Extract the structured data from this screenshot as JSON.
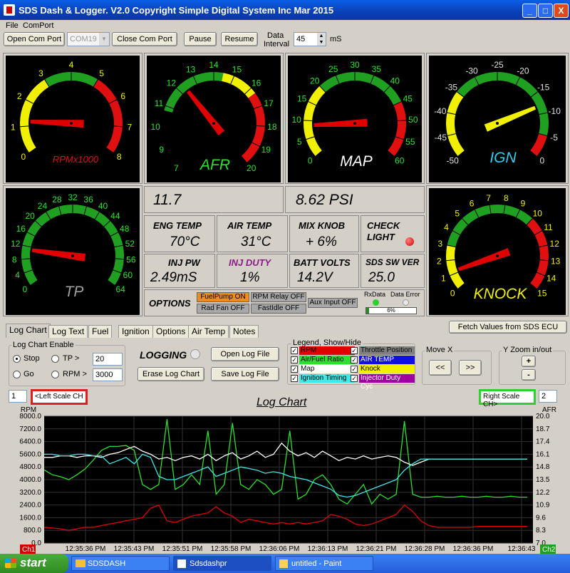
{
  "window": {
    "title": "SDS Dash & Logger. V2.0 Copyright Simple Digital System Inc Mar 2015",
    "min": "_",
    "max": "□",
    "close": "X"
  },
  "menu": {
    "file": "File",
    "comport": "ComPort"
  },
  "toolbar": {
    "open_com": "Open Com Port",
    "com_value": "COM19",
    "close_com": "Close Com Port",
    "pause": "Pause",
    "resume": "Resume",
    "interval_label_1": "Data",
    "interval_label_2": "Interval",
    "interval_value": "45",
    "interval_unit": "mS"
  },
  "gauges": {
    "rpm": {
      "label": "RPMx1000",
      "ticks": [
        "0",
        "1",
        "2",
        "3",
        "4",
        "5",
        "6",
        "7",
        "8"
      ],
      "value": 1.2
    },
    "afr": {
      "label": "AFR",
      "ticks": [
        "7",
        "9",
        "10",
        "11",
        "12",
        "13",
        "14",
        "15",
        "16",
        "17",
        "18",
        "19",
        "20"
      ],
      "value": 11.7
    },
    "map": {
      "label": "MAP",
      "ticks": [
        "0",
        "5",
        "10",
        "15",
        "20",
        "25",
        "30",
        "35",
        "40",
        "45",
        "50",
        "55",
        "60"
      ],
      "value": 8.62
    },
    "ign": {
      "label": "IGN",
      "ticks": [
        "-50",
        "-45",
        "-40",
        "-35",
        "-30",
        "-25",
        "-20",
        "-15",
        "-10",
        "-5",
        "0"
      ],
      "value": -12
    },
    "tp": {
      "label": "TP",
      "ticks": [
        "0",
        "4",
        "8",
        "12",
        "16",
        "20",
        "24",
        "28",
        "32",
        "36",
        "40",
        "44",
        "48",
        "52",
        "56",
        "60",
        "64"
      ],
      "value": 11
    },
    "knock": {
      "label": "KNOCK",
      "ticks": [
        "0",
        "1",
        "2",
        "3",
        "4",
        "5",
        "6",
        "7",
        "8",
        "9",
        "10",
        "11",
        "12",
        "13",
        "14",
        "15"
      ],
      "value": 1.2
    }
  },
  "readouts": {
    "afr": "11.7",
    "map": "8.62 PSI"
  },
  "cells": {
    "eng_temp_label": "ENG TEMP",
    "eng_temp": "70°C",
    "air_temp_label": "AIR TEMP",
    "air_temp": "31°C",
    "mix_knob_label": "MIX KNOB",
    "mix_knob": "+ 6%",
    "check_light_1": "CHECK",
    "check_light_2": "LIGHT",
    "inj_pw_label": "INJ PW",
    "inj_pw": "2.49mS",
    "inj_duty_label": "INJ DUTY",
    "inj_duty": "1%",
    "batt_label": "BATT VOLTS",
    "batt": "14.2V",
    "sw_ver_label": "SDS SW  VER",
    "sw_ver": "25.0"
  },
  "options": {
    "label": "OPTIONS",
    "fuelpump": "FuelPump ON",
    "rpm_relay": "RPM Relay OFF",
    "aux": "Aux Input OFF",
    "radfan": "Rad Fan OFF",
    "fastidle": "FastIdle OFF",
    "rxdata": "RxData",
    "data_error": "Data Error",
    "progress": "6%",
    "progress_frac": 0.06
  },
  "tabs": [
    "Log Chart",
    "Log Text",
    "Fuel",
    "Ignition",
    "Options",
    "Air Temp",
    "Notes"
  ],
  "fetch": "Fetch Values from SDS ECU",
  "logctl": {
    "enable_label": "Log Chart Enable",
    "stop": "Stop",
    "go": "Go",
    "tp": "TP >",
    "rpm": "RPM >",
    "tp_value": "20",
    "rpm_value": "3000",
    "logging": "LOGGING",
    "open_log": "Open Log File",
    "erase": "Erase Log Chart",
    "save_log": "Save Log File"
  },
  "legend": {
    "title": "Legend, Show/Hide",
    "items": [
      {
        "label": "RPM",
        "color": "#e00000"
      },
      {
        "label": "Air/Fuel Ratio",
        "color": "#2ee02e"
      },
      {
        "label": "Map",
        "color": "#ffffff"
      },
      {
        "label": "Ignition Timing",
        "color": "#40e8e8"
      },
      {
        "label": "Throttle Position",
        "color": "#808080"
      },
      {
        "label": "AIR TEMP",
        "color": "#1010e0"
      },
      {
        "label": "Knock",
        "color": "#f0f000"
      },
      {
        "label": "Injector Duty Cyc",
        "color": "#a000a0"
      }
    ]
  },
  "movex": {
    "label": "Move X",
    "left": "<<",
    "right": ">>"
  },
  "yzoom": {
    "label": "Y Zoom in/out",
    "plus": "+",
    "minus": "-"
  },
  "chart_header": {
    "left_ch": "1",
    "left_scale": "<Left Scale CH",
    "title": "Log Chart",
    "right_scale": "Right Scale CH>",
    "right_ch": "2"
  },
  "chart_data": {
    "type": "line",
    "title": "Log Chart",
    "ylabel_left": "RPM",
    "ylabel_right": "AFR",
    "y_left_ticks": [
      "8000.0",
      "7200.0",
      "6400.0",
      "5600.0",
      "4800.0",
      "4000.0",
      "3200.0",
      "2400.0",
      "1600.0",
      "800.0",
      "0.0"
    ],
    "y_right_ticks": [
      "20.0",
      "18.7",
      "17.4",
      "16.1",
      "14.8",
      "13.5",
      "12.2",
      "10.9",
      "9.6",
      "8.3",
      "7.0"
    ],
    "x_ticks": [
      "12:35:36 PM",
      "12:35:43 PM",
      "12:35:51 PM",
      "12:35:58 PM",
      "12:36:06 PM",
      "12:36:13 PM",
      "12:36:21 PM",
      "12:36:28 PM",
      "12:36:36 PM",
      "12:36:43"
    ],
    "ch_left": "Ch1",
    "ch_right": "Ch2",
    "series": [
      {
        "name": "RPM",
        "color": "#e00000",
        "axis": "left",
        "values": [
          1000,
          950,
          900,
          800,
          900,
          1000,
          1000,
          1100,
          1200,
          1300,
          1400,
          1500,
          1600,
          2200,
          2400,
          1400,
          1300,
          1500,
          1700,
          1800,
          1900,
          2300,
          1900,
          1700,
          1300,
          1500,
          1400,
          1300,
          1200,
          1300,
          1200,
          1300,
          1200,
          1300,
          1400,
          1800,
          1700,
          1500,
          1200,
          1100,
          1200,
          1400,
          1600,
          1800,
          2400,
          2000,
          1400,
          1100,
          1000,
          1000,
          1000,
          1000,
          1000,
          1050,
          1050,
          1050,
          1050,
          1050,
          1050,
          1050
        ]
      },
      {
        "name": "Air/Fuel Ratio",
        "color": "#2ee02e",
        "axis": "right",
        "values": [
          14.5,
          14.0,
          13.8,
          13.5,
          14.0,
          14.6,
          15.5,
          16.5,
          16.9,
          16.9,
          17.0,
          16.5,
          13.0,
          12.5,
          13.0,
          19.7,
          12.5,
          13.0,
          14.0,
          13.0,
          18.5,
          12.0,
          13.0,
          19.3,
          13.0,
          12.5,
          13.5,
          13.0,
          12.0,
          12.5,
          18.5,
          11.5,
          12.0,
          13.5,
          14.0,
          13.0,
          11.5,
          11.0,
          12.0,
          13.0,
          11.0,
          12.0,
          11.5,
          12.0,
          19.5,
          12.0,
          11.7,
          11.7,
          11.8,
          11.7,
          11.7,
          11.8,
          11.7,
          11.7,
          11.8,
          11.7,
          11.7,
          11.8,
          11.7,
          11.7
        ]
      },
      {
        "name": "Map",
        "color": "#ffffff",
        "axis": "left",
        "values": [
          5400,
          5400,
          5500,
          5500,
          5400,
          5500,
          5500,
          5400,
          5600,
          5700,
          5900,
          6100,
          5800,
          5600,
          5300,
          5400,
          5200,
          5400,
          5500,
          5300,
          5600,
          5200,
          5500,
          5700,
          5300,
          5500,
          5800,
          5400,
          5600,
          6300,
          5800,
          5500,
          5700,
          5400,
          5800,
          5500,
          5200,
          5400,
          5300,
          5500,
          5300,
          5400,
          5500,
          5400,
          5100,
          4900,
          5100,
          5300,
          5300,
          5300,
          5300,
          5300,
          5300,
          5300,
          5300,
          5300,
          5300,
          5300,
          5300,
          5300
        ]
      },
      {
        "name": "Ignition Timing",
        "color": "#40e8e8",
        "axis": "left",
        "values": [
          5600,
          5600,
          5500,
          5500,
          5600,
          5600,
          5500,
          5500,
          5000,
          5200,
          5400,
          5000,
          5600,
          5400,
          4200,
          4000,
          4000,
          4200,
          4400,
          4600,
          4800,
          4200,
          4400,
          4600,
          4800,
          4700,
          4600,
          4400,
          4500,
          4400,
          4200,
          4100,
          4000,
          3800,
          3600,
          3400,
          3000,
          2900,
          3000,
          3200,
          3400,
          3600,
          3800,
          4000,
          4600,
          5000,
          5300,
          5300,
          5300,
          5300,
          5300,
          5300,
          5300,
          5300,
          5300,
          5300,
          5300,
          5300,
          5300,
          5300
        ]
      }
    ]
  },
  "taskbar": {
    "start": "start",
    "item1": "SDSDASH",
    "item2": "Sdsdashpr",
    "item3": "untitled - Paint"
  }
}
